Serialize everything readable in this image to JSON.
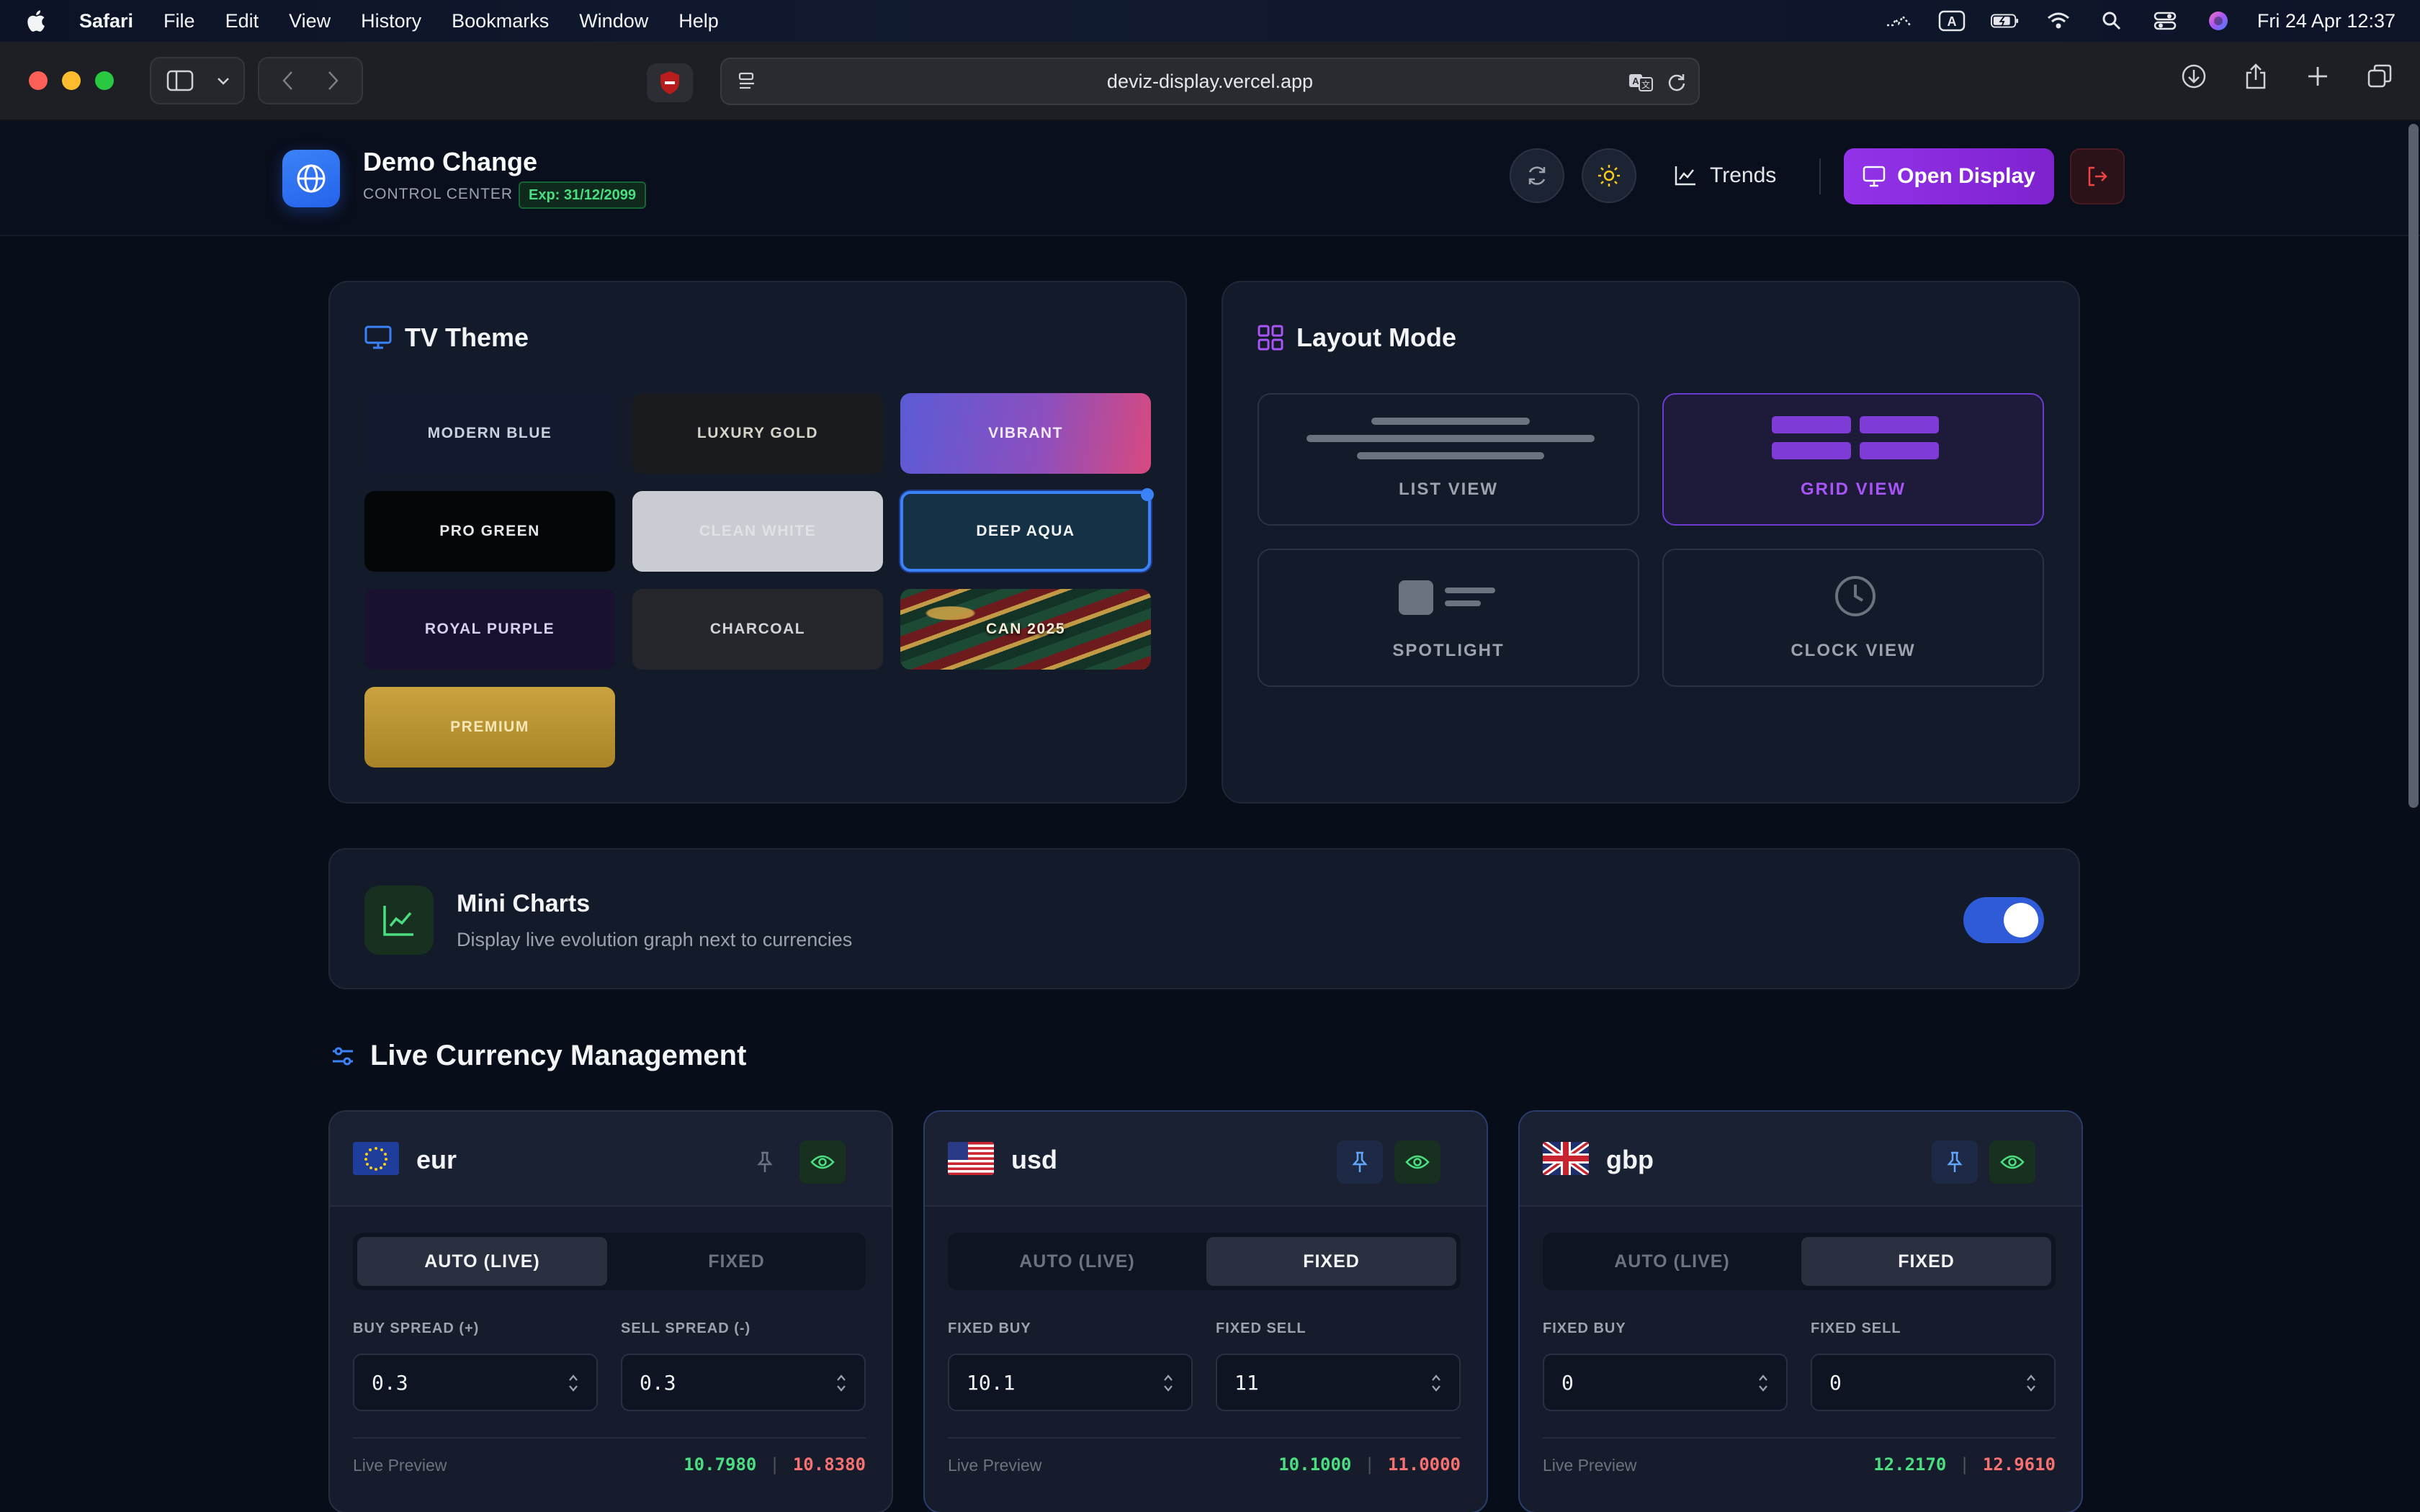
{
  "menubar": {
    "app": "Safari",
    "items": [
      "File",
      "Edit",
      "View",
      "History",
      "Bookmarks",
      "Window",
      "Help"
    ],
    "clock": "Fri 24 Apr  12:37"
  },
  "browser": {
    "url": "deviz-display.vercel.app"
  },
  "header": {
    "title": "Demo Change",
    "subtitle": "CONTROL CENTER",
    "expiry": "Exp: 31/12/2099",
    "trends_label": "Trends",
    "open_display_label": "Open Display"
  },
  "tv_theme": {
    "title": "TV Theme",
    "selected": "DEEP AQUA",
    "themes": [
      {
        "label": "MODERN BLUE"
      },
      {
        "label": "LUXURY GOLD"
      },
      {
        "label": "VIBRANT"
      },
      {
        "label": "PRO GREEN"
      },
      {
        "label": "CLEAN WHITE"
      },
      {
        "label": "DEEP AQUA"
      },
      {
        "label": "ROYAL PURPLE"
      },
      {
        "label": "CHARCOAL"
      },
      {
        "label": "CAN 2025"
      },
      {
        "label": "PREMIUM"
      }
    ]
  },
  "layout_mode": {
    "title": "Layout Mode",
    "selected": "GRID VIEW",
    "options": [
      {
        "label": "LIST VIEW"
      },
      {
        "label": "GRID VIEW"
      },
      {
        "label": "SPOTLIGHT"
      },
      {
        "label": "CLOCK VIEW"
      }
    ]
  },
  "mini_charts": {
    "title": "Mini Charts",
    "description": "Display live evolution graph next to currencies",
    "enabled": true
  },
  "currency_management": {
    "title": "Live Currency Management",
    "currencies": [
      {
        "code": "eur",
        "mode_auto": "AUTO (LIVE)",
        "mode_fixed": "FIXED",
        "active_mode": "AUTO (LIVE)",
        "field1_label": "BUY SPREAD (+)",
        "field1_value": "0.3",
        "field2_label": "SELL SPREAD (-)",
        "field2_value": "0.3",
        "preview_label": "Live Preview",
        "preview_buy": "10.7980",
        "preview_sell": "10.8380",
        "pinned": false
      },
      {
        "code": "usd",
        "mode_auto": "AUTO (LIVE)",
        "mode_fixed": "FIXED",
        "active_mode": "FIXED",
        "field1_label": "FIXED BUY",
        "field1_value": "10.1",
        "field2_label": "FIXED SELL",
        "field2_value": "11",
        "preview_label": "Live Preview",
        "preview_buy": "10.1000",
        "preview_sell": "11.0000",
        "pinned": true
      },
      {
        "code": "gbp",
        "mode_auto": "AUTO (LIVE)",
        "mode_fixed": "FIXED",
        "active_mode": "FIXED",
        "field1_label": "FIXED BUY",
        "field1_value": "0",
        "field2_label": "FIXED SELL",
        "field2_value": "0",
        "preview_label": "Live Preview",
        "preview_buy": "12.2170",
        "preview_sell": "12.9610",
        "pinned": true
      }
    ]
  },
  "colors": {
    "accent_blue": "#2563eb",
    "accent_purple": "#9333ea",
    "buy_green": "#4ade80",
    "sell_red": "#f87171"
  }
}
